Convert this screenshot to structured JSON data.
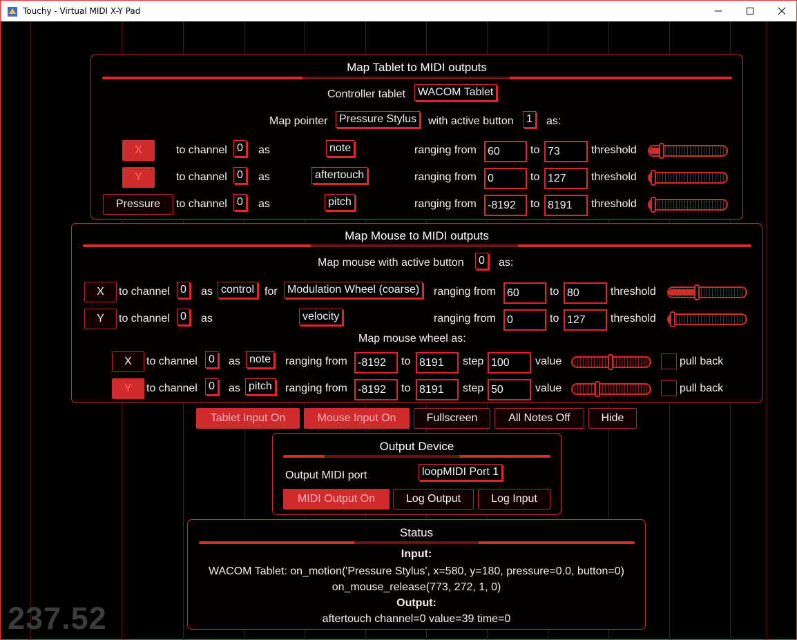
{
  "window": {
    "title": "Touchy - Virtual MIDI X-Y Pad"
  },
  "tablet_panel": {
    "title": "Map Tablet to MIDI outputs",
    "controller_label": "Controller tablet",
    "controller_value": "WACOM Tablet",
    "map_pointer_label": "Map pointer",
    "pointer_value": "Pressure Stylus",
    "active_button_label": "with active button",
    "active_button_value": "1",
    "as_label": "as:",
    "rows": [
      {
        "axis": "X",
        "axis_active": true,
        "channel": "0",
        "mapping": "note",
        "from": "60",
        "to": "73",
        "threshold": 0.12
      },
      {
        "axis": "Y",
        "axis_active": true,
        "channel": "0",
        "mapping": "aftertouch",
        "from": "0",
        "to": "127",
        "threshold": 0.0
      },
      {
        "axis": "Pressure",
        "axis_active": false,
        "channel": "0",
        "mapping": "pitch",
        "from": "-8192",
        "to": "8191",
        "threshold": 0.0
      }
    ]
  },
  "mouse_panel": {
    "title": "Map Mouse to MIDI outputs",
    "active_button_label": "Map mouse with active button",
    "active_button_value": "0",
    "as_label": "as:",
    "rows": [
      {
        "axis": "X",
        "channel": "0",
        "mapping": "control",
        "for_label": "for",
        "controller": "Modulation Wheel (coarse)",
        "from": "60",
        "to": "80",
        "threshold": 0.36
      },
      {
        "axis": "Y",
        "channel": "0",
        "mapping": "velocity",
        "from": "0",
        "to": "127",
        "threshold": 0.0
      }
    ],
    "wheel_label": "Map mouse wheel as:",
    "wheel_rows": [
      {
        "axis": "X",
        "axis_active": false,
        "channel": "0",
        "mapping": "note",
        "from": "-8192",
        "to": "8191",
        "step": "100",
        "value": 0.5,
        "pull_back": false
      },
      {
        "axis": "Y",
        "axis_active": true,
        "channel": "0",
        "mapping": "pitch",
        "from": "-8192",
        "to": "8191",
        "step": "50",
        "value": 0.31,
        "pull_back": false
      }
    ]
  },
  "labels": {
    "to_channel": "to channel",
    "as": "as",
    "ranging_from": "ranging from",
    "to": "to",
    "threshold": "threshold",
    "step": "step",
    "value": "value",
    "pull_back": "pull back"
  },
  "toolbar": {
    "tablet_input": "Tablet Input On",
    "mouse_input": "Mouse Input On",
    "fullscreen": "Fullscreen",
    "all_notes_off": "All Notes Off",
    "hide": "Hide"
  },
  "output_panel": {
    "title": "Output Device",
    "port_label": "Output MIDI port",
    "port_value": "loopMIDI Port 1",
    "midi_output": "MIDI Output On",
    "log_output": "Log Output",
    "log_input": "Log Input"
  },
  "status_panel": {
    "title": "Status",
    "input_heading": "Input:",
    "input_line1": "WACOM Tablet: on_motion('Pressure Stylus', x=580, y=180, pressure=0.0, button=0)",
    "input_line2": "on_mouse_release(773, 272, 1, 0)",
    "output_heading": "Output:",
    "output_line": "aftertouch channel=0 value=39 time=0"
  },
  "fps": "237.52",
  "colors": {
    "accent": "#d12b2e",
    "background": "#000000",
    "grid": "#5a1416"
  }
}
